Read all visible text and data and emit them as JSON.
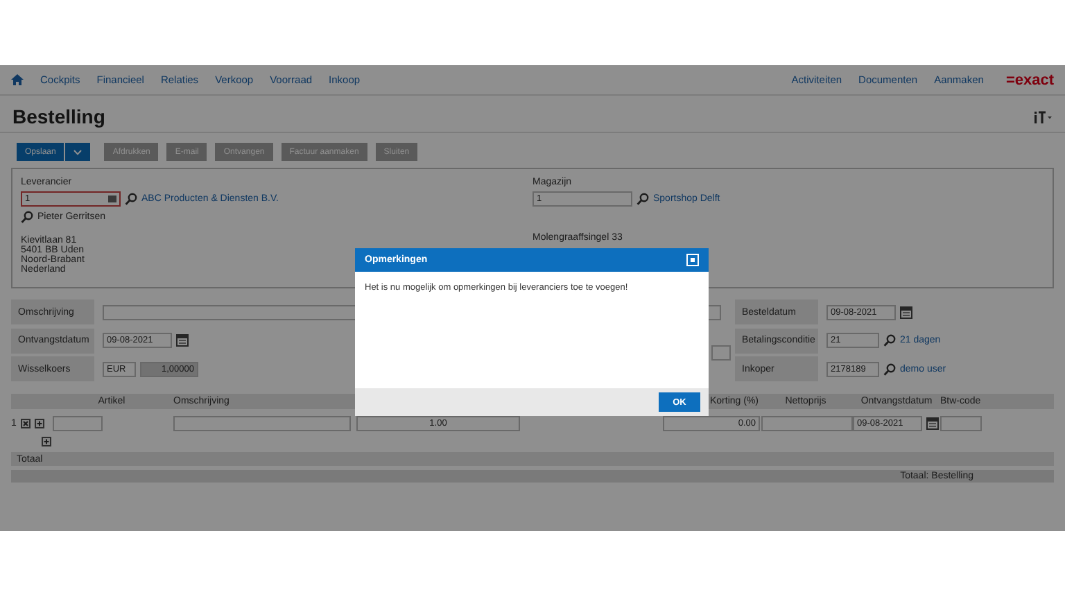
{
  "nav": {
    "items": [
      "Cockpits",
      "Financieel",
      "Relaties",
      "Verkoop",
      "Voorraad",
      "Inkoop"
    ],
    "links": [
      "Activiteiten",
      "Documenten",
      "Aanmaken"
    ],
    "logo": "=exact"
  },
  "page_title": "Bestelling",
  "toolbar": {
    "primary": "Opslaan",
    "buttons": [
      "Afdrukken",
      "E-mail",
      "Ontvangen",
      "Factuur aanmaken",
      "Sluiten"
    ]
  },
  "supplier": {
    "label": "Leverancier",
    "code": "1",
    "name": "ABC Producten & Diensten B.V.",
    "contact": "Pieter Gerritsen",
    "address": [
      "Kievitlaan 81",
      "5401 BB Uden",
      "Noord-Brabant",
      "Nederland"
    ]
  },
  "warehouse": {
    "label": "Magazijn",
    "code": "1",
    "name": "Sportshop Delft",
    "address": [
      "Molengraaffsingel 33"
    ]
  },
  "header_left": [
    {
      "kind": "text",
      "label": "Omschrijving"
    },
    {
      "kind": "date",
      "label": "Ontvangstdatum",
      "value": "09-08-2021"
    },
    {
      "kind": "currency",
      "label": "Wisselkoers",
      "value": "EUR",
      "rate": "1,00000"
    }
  ],
  "header_right": [
    {
      "kind": "date",
      "label": "Besteldatum",
      "value": "09-08-2021"
    },
    {
      "kind": "lookup",
      "label": "Betalingsconditie",
      "value": "21",
      "link": "21 dagen"
    },
    {
      "kind": "lookup",
      "label": "Inkoper",
      "value": "2178189",
      "link": "demo user"
    }
  ],
  "lines": {
    "columns": [
      "Artikel",
      "Omschrijving",
      "Korting (%)",
      "Nettoprijs",
      "Ontvangstdatum",
      "Btw-code"
    ],
    "rows": [
      {
        "number": "1",
        "quantity": "1.00",
        "discount": "0.00",
        "receive_date": "09-08-2021"
      }
    ]
  },
  "totals": {
    "label": "Totaal",
    "footer": "Totaal: Bestelling"
  },
  "modal": {
    "title": "Opmerkingen",
    "message": "Het is nu mogelijk om opmerkingen bij leveranciers toe te voegen!",
    "ok": "OK"
  }
}
